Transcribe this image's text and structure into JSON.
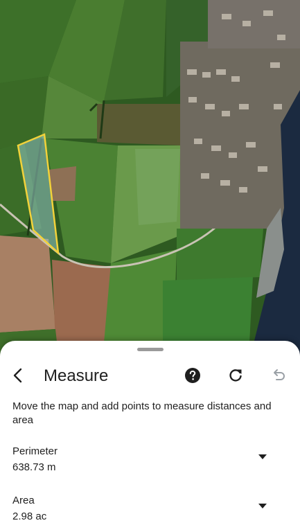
{
  "header": {
    "title": "Measure",
    "back_icon": "chevron-left-icon",
    "help_icon": "help-circle-icon",
    "refresh_icon": "refresh-icon",
    "undo_icon": "undo-icon"
  },
  "instructions": "Move the map and add points to measure distances and area",
  "measurements": [
    {
      "label": "Perimeter",
      "value": "638.73 m"
    },
    {
      "label": "Area",
      "value": "2.98 ac"
    }
  ],
  "colors": {
    "measured_outline": "#f2d23a",
    "disabled_icon": "#9aa0a6",
    "text": "#1f1f1f"
  }
}
